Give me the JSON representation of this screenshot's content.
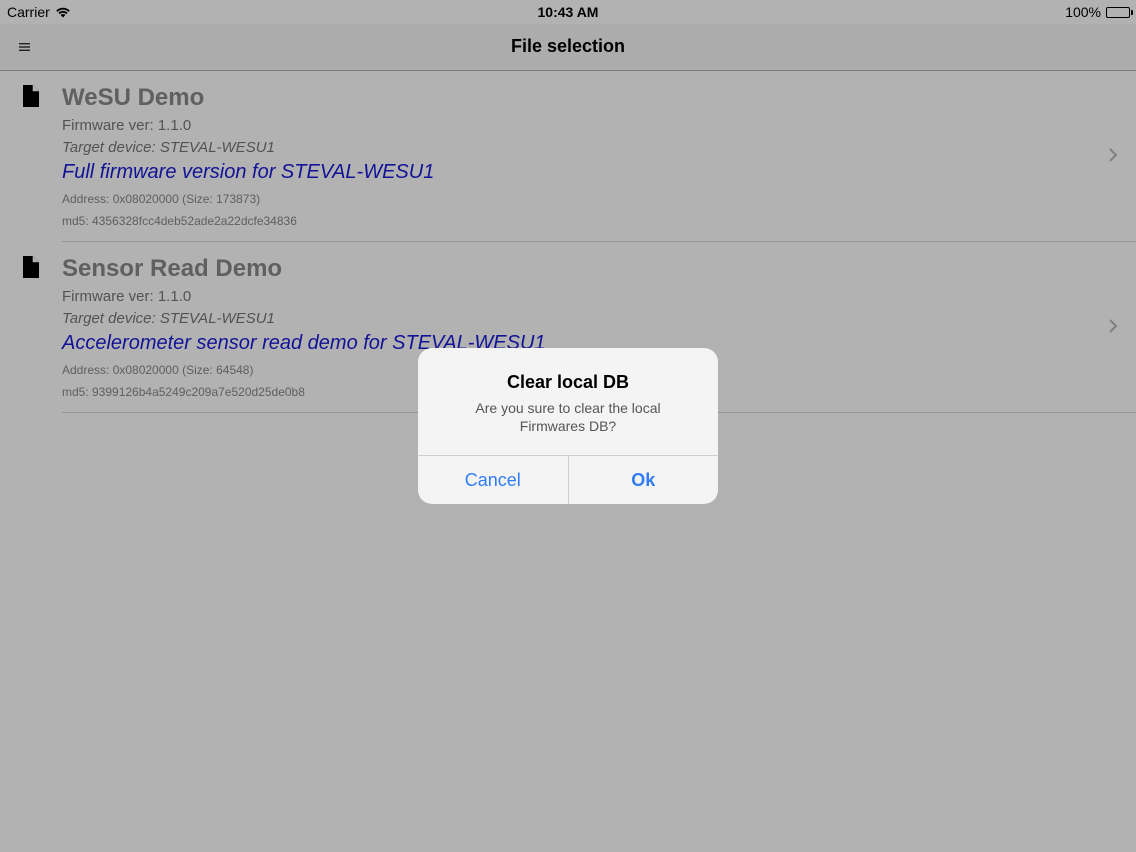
{
  "status_bar": {
    "carrier": "Carrier",
    "time": "10:43 AM",
    "battery": "100%"
  },
  "nav": {
    "title": "File selection",
    "menu_icon": "hamburger-menu-icon"
  },
  "files": [
    {
      "name": "WeSU Demo",
      "firmware_version": "Firmware ver: 1.1.0",
      "target_device": "Target device: STEVAL-WESU1",
      "description": "Full firmware version for STEVAL-WESU1",
      "address": "Address: 0x08020000 (Size: 173873)",
      "md5": "md5: 4356328fcc4deb52ade2a22dcfe34836"
    },
    {
      "name": "Sensor Read Demo",
      "firmware_version": "Firmware ver: 1.1.0",
      "target_device": "Target device: STEVAL-WESU1",
      "description": "Accelerometer sensor read demo for STEVAL-WESU1",
      "address": "Address: 0x08020000 (Size: 64548)",
      "md5": "md5: 9399126b4a5249c209a7e520d25de0b8"
    }
  ],
  "alert": {
    "title": "Clear local DB",
    "message": "Are you sure to clear the local Firmwares DB?",
    "cancel_label": "Cancel",
    "ok_label": "Ok"
  },
  "colors": {
    "accent": "#2f7cf6",
    "description_blue": "#1a1ad8",
    "name_gray": "#8a8a8a"
  }
}
